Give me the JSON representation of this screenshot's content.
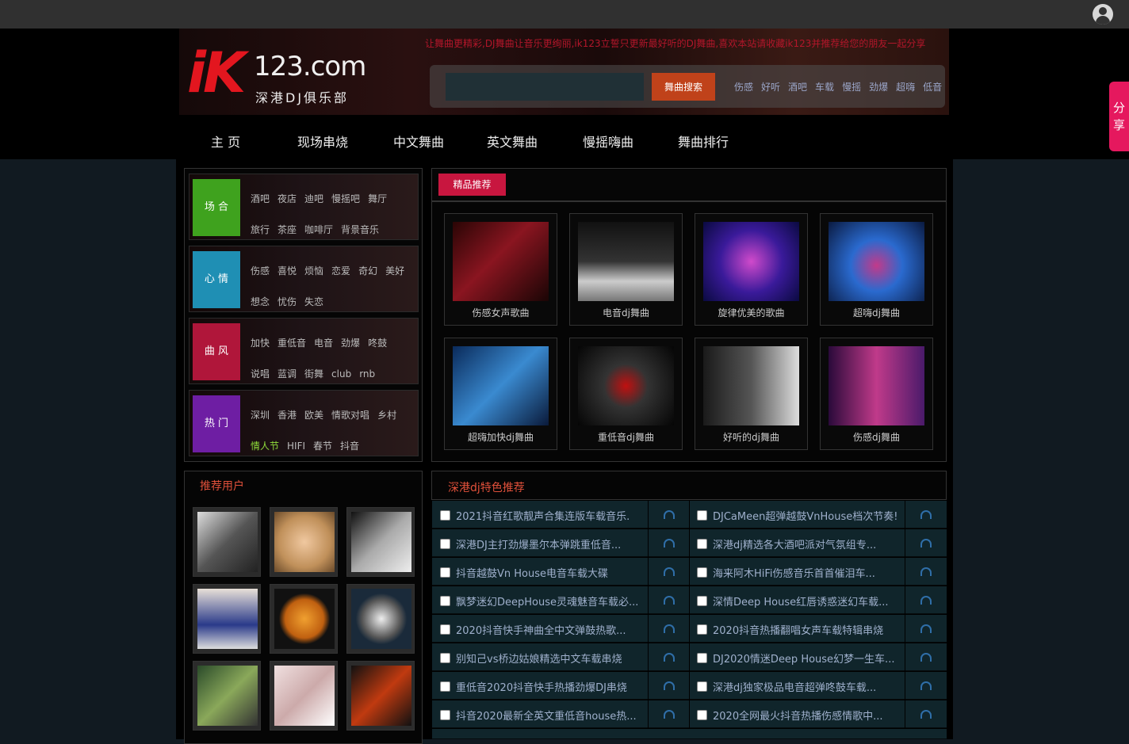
{
  "header": {
    "marquee": "让舞曲更精彩,DJ舞曲让音乐更绚丽,ik123立誓只更新最好听的DJ舞曲,喜欢本站请收藏ik123并推荐给您的朋友一起分享",
    "logo_main": "iK",
    "logo_domain": "123.com",
    "logo_sub": "深港DJ俱乐部",
    "search_placeholder": "",
    "search_button": "舞曲搜索",
    "tags": [
      "伤感",
      "好听",
      "酒吧",
      "车载",
      "慢摇",
      "劲爆",
      "超嗨",
      "低音"
    ]
  },
  "nav": [
    "主 页",
    "现场串烧",
    "中文舞曲",
    "英文舞曲",
    "慢摇嗨曲",
    "舞曲排行"
  ],
  "share_label": "分享",
  "categories": [
    {
      "label": "场 合",
      "color": "#3fa21e",
      "items": [
        "酒吧",
        "夜店",
        "迪吧",
        "慢摇吧",
        "舞厅",
        "旅行",
        "茶座",
        "咖啡厅",
        "背景音乐"
      ]
    },
    {
      "label": "心 情",
      "color": "#1f8fb4",
      "items": [
        "伤感",
        "喜悦",
        "烦恼",
        "恋爱",
        "奇幻",
        "美好",
        "想念",
        "忧伤",
        "失恋"
      ]
    },
    {
      "label": "曲 风",
      "color": "#b0163a",
      "items": [
        "加快",
        "重低音",
        "电音",
        "劲爆",
        "咚鼓",
        "说唱",
        "蓝调",
        "街舞",
        "club",
        "rnb"
      ]
    },
    {
      "label": "热 门",
      "color": "#6e1ea3",
      "items": [
        "深圳",
        "香港",
        "欧美",
        "情歌对唱",
        "乡村",
        "情人节",
        "HIFI",
        "春节",
        "抖音"
      ]
    }
  ],
  "featured": {
    "tab": "精品推荐",
    "items": [
      "伤感女声歌曲",
      "电音dj舞曲",
      "旋律优美的歌曲",
      "超嗨dj舞曲",
      "超嗨加快dj舞曲",
      "重低音dj舞曲",
      "好听的dj舞曲",
      "伤感dj舞曲"
    ]
  },
  "users": {
    "title": "推荐用户"
  },
  "list": {
    "title": "深港dj特色推荐",
    "left": [
      "2021抖音红歌靓声合集连版车载音乐.",
      "深港DJ主打劲爆墨尔本弹跳重低音...",
      "抖音越鼓Vn House电音车载大碟",
      "飘梦迷幻DeepHouse灵魂魅音车载必...",
      "2020抖音快手神曲全中文弹鼓热歌...",
      "别知己vs桥边姑娘精选中文车载串烧",
      "重低音2020抖音快手热播劲爆DJ串烧",
      "抖音2020最新全英文重低音house热..."
    ],
    "right": [
      "DJCaMeen超弹越鼓VnHouse档次节奏!",
      "深港dj精选各大酒吧派对气氛组专...",
      "海来阿木HiFi伤感音乐首首催泪车...",
      "深情Deep House红唇诱惑迷幻车载...",
      "2020抖音热播翻唱女声车载特辑串烧",
      "DJ2020情迷Deep House幻梦一生车...",
      "深港dj独家极品电音超弹咚鼓车载...",
      "2020全网最火抖音热播伤感情歌中..."
    ]
  },
  "colors": {
    "accent": "#c8163f",
    "row_bg": "#10252b",
    "link": "#9fb0cc"
  }
}
